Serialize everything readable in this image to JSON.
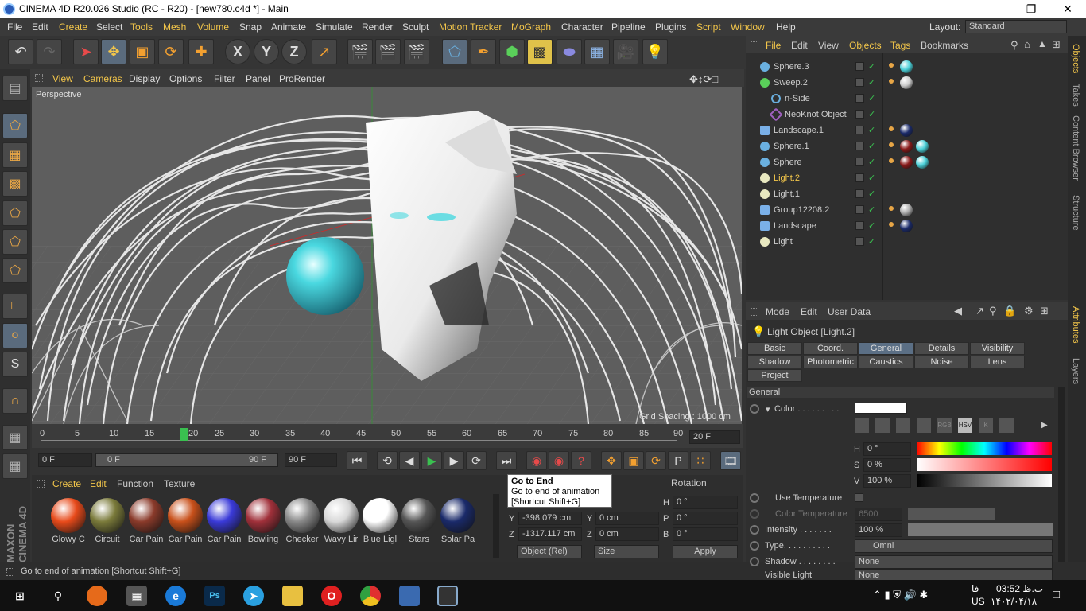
{
  "window": {
    "title": "CINEMA 4D R20.026 Studio (RC - R20) - [new780.c4d *] - Main"
  },
  "menubar": {
    "items": [
      "File",
      "Edit",
      "Create",
      "Select",
      "Tools",
      "Mesh",
      "Volume",
      "Snap",
      "Animate",
      "Simulate",
      "Render",
      "Sculpt",
      "Motion Tracker",
      "MoGraph",
      "Character",
      "Pipeline",
      "Plugins",
      "Script",
      "Window",
      "Help"
    ],
    "layout_label": "Layout:",
    "layout_value": "Standard"
  },
  "toolbar": {
    "axis_x": "X",
    "axis_y": "Y",
    "axis_z": "Z"
  },
  "viewport": {
    "menu": [
      "View",
      "Cameras",
      "Display",
      "Options",
      "Filter",
      "Panel",
      "ProRender"
    ],
    "label": "Perspective",
    "grid_spacing": "Grid Spacing : 1000 cm"
  },
  "timeline": {
    "ticks": [
      "0",
      "5",
      "10",
      "15",
      "20",
      "25",
      "30",
      "35",
      "40",
      "45",
      "50",
      "55",
      "60",
      "65",
      "70",
      "75",
      "80",
      "85",
      "90"
    ],
    "current_frame": "20 F",
    "start": "0 F",
    "range_start": "0 F",
    "range_end": "90 F",
    "end": "90 F"
  },
  "materials": {
    "menu": [
      "Create",
      "Edit",
      "Function",
      "Texture"
    ],
    "items": [
      {
        "name": "Glowy C",
        "color": "#e84a1a"
      },
      {
        "name": "Circuit",
        "color": "#7a7a3a"
      },
      {
        "name": "Car Pain",
        "color": "#8a3a2a"
      },
      {
        "name": "Car Pain",
        "color": "#c8501a"
      },
      {
        "name": "Car Pain",
        "color": "#3a3ad8"
      },
      {
        "name": "Bowling",
        "color": "#a0303a"
      },
      {
        "name": "Checker",
        "color": "#888888"
      },
      {
        "name": "Wavy Lir",
        "color": "#d8d8d8"
      },
      {
        "name": "Blue Ligl",
        "color": "#ffffff"
      },
      {
        "name": "Stars",
        "color": "#555555"
      },
      {
        "name": "Solar Pa",
        "color": "#1a2a6a"
      }
    ]
  },
  "coords": {
    "rotation_label": "Rotation",
    "y_pos": "-398.079 cm",
    "z_pos": "-1317.117 cm",
    "y_size": "0 cm",
    "z_size": "0 cm",
    "h_rot": "0 °",
    "p_rot": "0 °",
    "b_rot": "0 °",
    "mode": "Object (Rel)",
    "size": "Size",
    "apply": "Apply"
  },
  "tooltip": {
    "title": "Go to End",
    "desc": "Go to end of animation",
    "shortcut": "[Shortcut Shift+G]"
  },
  "status": "Go to end of animation [Shortcut Shift+G]",
  "objects": {
    "menu": [
      "File",
      "Edit",
      "View",
      "Objects",
      "Tags",
      "Bookmarks"
    ],
    "items": [
      {
        "name": "Sphere.3",
        "indent": 0,
        "tags": [
          "#4ad0d8"
        ]
      },
      {
        "name": "Sweep.2",
        "indent": 0,
        "tags": [
          "#cccccc"
        ]
      },
      {
        "name": "n-Side",
        "indent": 1,
        "tags": []
      },
      {
        "name": "NeoKnot Object",
        "indent": 1,
        "tags": []
      },
      {
        "name": "Landscape.1",
        "indent": 0,
        "tags": [
          "#1a2a6a"
        ]
      },
      {
        "name": "Sphere.1",
        "indent": 0,
        "tags": [
          "#8a1a1a",
          "#4ad0d8"
        ]
      },
      {
        "name": "Sphere",
        "indent": 0,
        "tags": [
          "#8a1a1a",
          "#4ad0d8"
        ]
      },
      {
        "name": "Light.2",
        "indent": 0,
        "tags": [],
        "active": true
      },
      {
        "name": "Light.1",
        "indent": 0,
        "tags": []
      },
      {
        "name": "Group12208.2",
        "indent": 0,
        "tags": [
          "#aaaaaa"
        ]
      },
      {
        "name": "Landscape",
        "indent": 0,
        "tags": [
          "#1a2a6a"
        ]
      },
      {
        "name": "Light",
        "indent": 0,
        "tags": []
      }
    ]
  },
  "attributes": {
    "menu": [
      "Mode",
      "Edit",
      "User Data"
    ],
    "object_title": "Light Object [Light.2]",
    "tabs_row1": [
      "Basic",
      "Coord.",
      "General",
      "Details",
      "Visibility"
    ],
    "tabs_row2": [
      "Shadow",
      "Photometric",
      "Caustics",
      "Noise",
      "Lens"
    ],
    "tabs_row3": [
      "Project"
    ],
    "section": "General",
    "color_label": "Color . . . . . . . . .",
    "h_value": "0 °",
    "s_value": "0 %",
    "v_value": "100 %",
    "use_temperature": "Use Temperature",
    "color_temperature": "Color Temperature",
    "color_temp_value": "6500",
    "intensity_label": "Intensity . . . . . . .",
    "intensity_value": "100 %",
    "type_label": "Type. . . . . . . . . .",
    "type_value": "Omni",
    "shadow_label": "Shadow . . . . . . . .",
    "shadow_value": "None",
    "visible_light_label": "Visible Light",
    "visible_light_value": "None"
  },
  "side_tabs": [
    "Objects",
    "Takes",
    "Content Browser",
    "Structure",
    "Attributes",
    "Layers"
  ],
  "taskbar": {
    "time": "03:52 ب.ظ",
    "date": "۱۴۰۲/۰۴/۱۸",
    "lang": "US",
    "lang2": "فا"
  }
}
